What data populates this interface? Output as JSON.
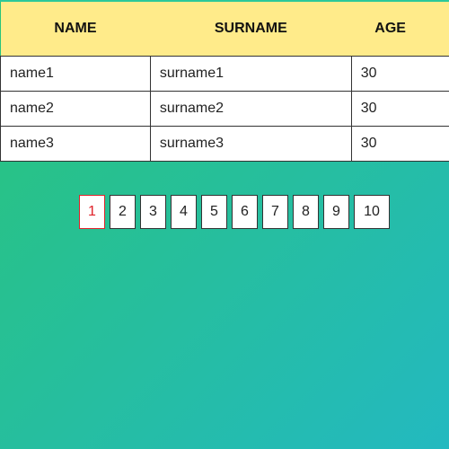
{
  "table": {
    "headers": {
      "name": "NAME",
      "surname": "SURNAME",
      "age": "AGE"
    },
    "rows": [
      {
        "name": "name1",
        "surname": "surname1",
        "age": "30"
      },
      {
        "name": "name2",
        "surname": "surname2",
        "age": "30"
      },
      {
        "name": "name3",
        "surname": "surname3",
        "age": "30"
      }
    ]
  },
  "pagination": {
    "pages": [
      "1",
      "2",
      "3",
      "4",
      "5",
      "6",
      "7",
      "8",
      "9",
      "10"
    ],
    "active_page": "1",
    "active_color": "#e0222a"
  },
  "colors": {
    "header_bg": "#ffeb8a",
    "gradient_start": "#29c47a",
    "gradient_end": "#23b9c0"
  }
}
